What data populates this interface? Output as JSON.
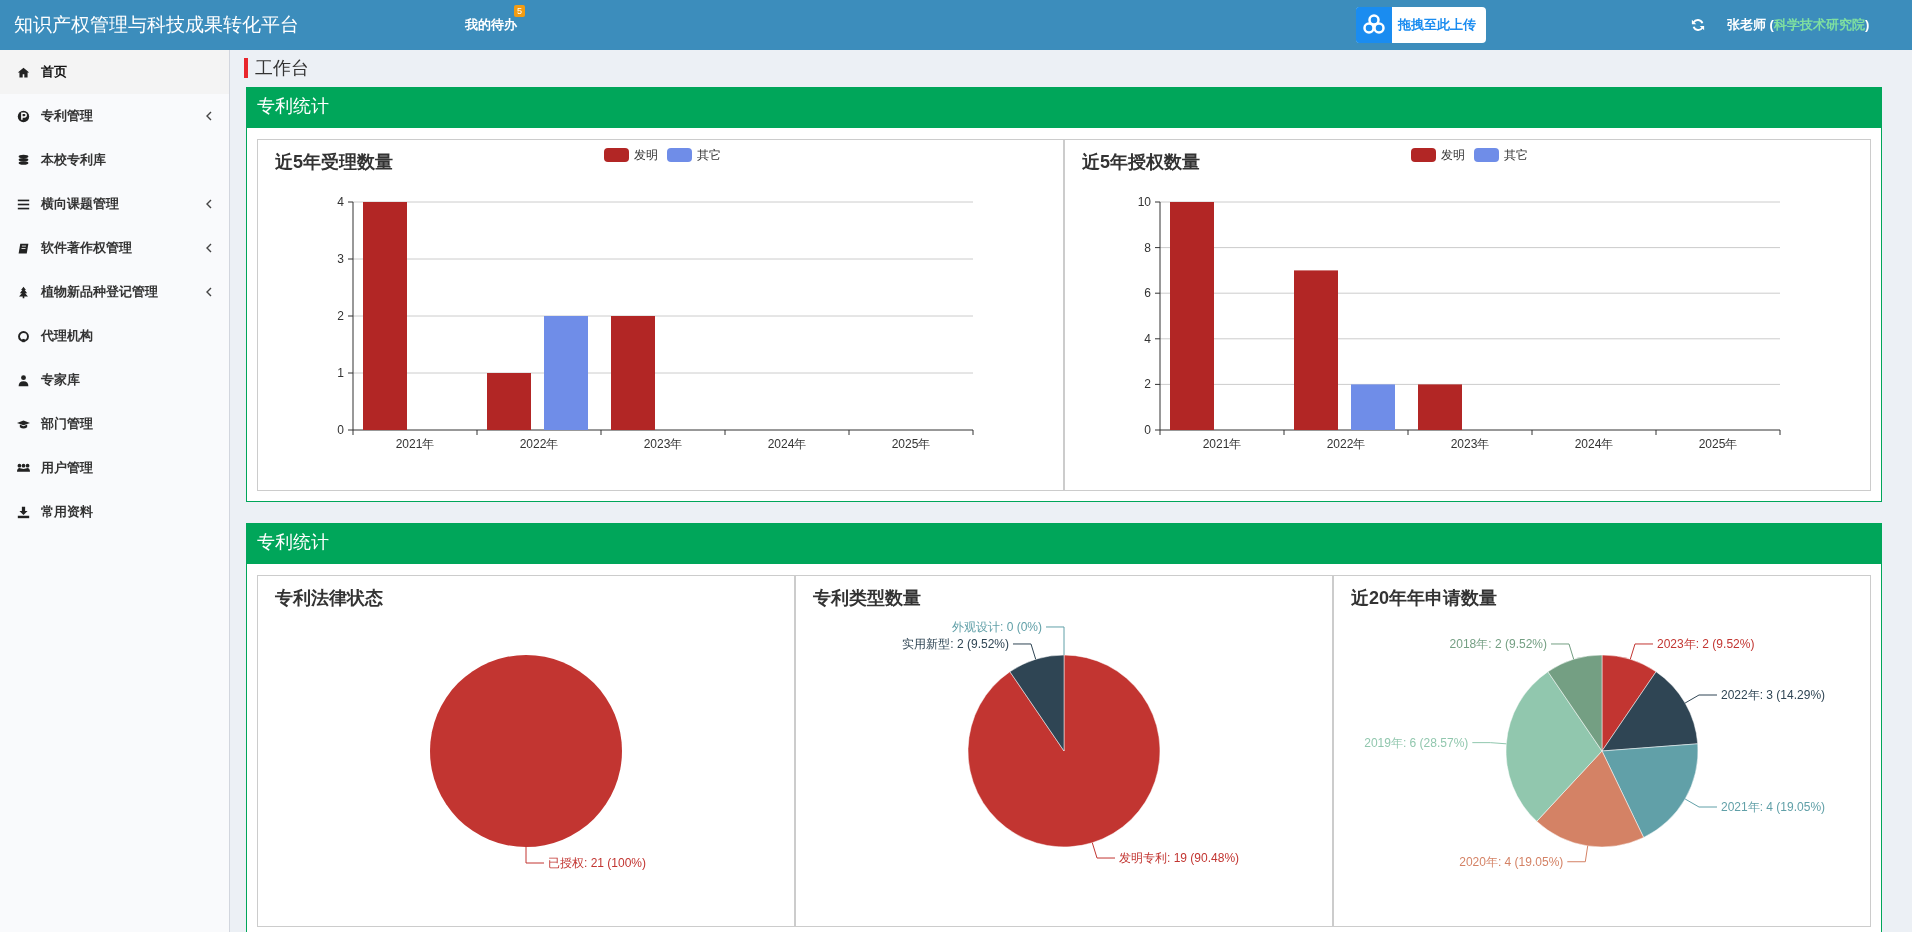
{
  "header": {
    "title": "知识产权管理与科技成果转化平台",
    "todo": {
      "label": "我的待办",
      "badge": "5"
    },
    "upload": {
      "label": "拖拽至此上传"
    },
    "user": "张老师 (**科学技术研究院**)"
  },
  "sidebar": {
    "items": [
      {
        "label": "首页",
        "selected": true,
        "submenu": false
      },
      {
        "label": "专利管理",
        "selected": false,
        "submenu": true
      },
      {
        "label": "本校专利库",
        "selected": false,
        "submenu": false
      },
      {
        "label": "横向课题管理",
        "selected": false,
        "submenu": true
      },
      {
        "label": "软件著作权管理",
        "selected": false,
        "submenu": true
      },
      {
        "label": "植物新品种登记管理",
        "selected": false,
        "submenu": true
      },
      {
        "label": "代理机构",
        "selected": false,
        "submenu": false
      },
      {
        "label": "专家库",
        "selected": false,
        "submenu": false
      },
      {
        "label": "部门管理",
        "selected": false,
        "submenu": false
      },
      {
        "label": "用户管理",
        "selected": false,
        "submenu": false
      },
      {
        "label": "常用资料",
        "selected": false,
        "submenu": false
      }
    ]
  },
  "breadcrumb": "工作台",
  "panels": [
    {
      "title": "专利统计",
      "charts": [
        {
          "chart_data": {
            "type": "bar",
            "title": "近5年受理数量",
            "categories": [
              "2021年",
              "2022年",
              "2023年",
              "2024年",
              "2025年"
            ],
            "series": [
              {
                "name": "发明",
                "color": "#b22625",
                "values": [
                  4,
                  1,
                  2,
                  0,
                  0
                ]
              },
              {
                "name": "其它",
                "color": "#6f8de8",
                "values": [
                  0,
                  2,
                  0,
                  0,
                  0
                ]
              }
            ],
            "ylim": [
              0,
              4
            ],
            "yticks": [
              0,
              1,
              2,
              3,
              4
            ],
            "grid": true,
            "legend": "top"
          }
        },
        {
          "chart_data": {
            "type": "bar",
            "title": "近5年授权数量",
            "categories": [
              "2021年",
              "2022年",
              "2023年",
              "2024年",
              "2025年"
            ],
            "series": [
              {
                "name": "发明",
                "color": "#b22625",
                "values": [
                  10,
                  7,
                  2,
                  0,
                  0
                ]
              },
              {
                "name": "其它",
                "color": "#6f8de8",
                "values": [
                  0,
                  2,
                  0,
                  0,
                  0
                ]
              }
            ],
            "ylim": [
              0,
              10
            ],
            "yticks": [
              0,
              2,
              4,
              6,
              8,
              10
            ],
            "grid": true,
            "legend": "top"
          }
        }
      ]
    },
    {
      "title": "专利统计",
      "charts": [
        {
          "chart_data": {
            "type": "pie",
            "title": "专利法律状态",
            "values": [
              21
            ],
            "colors": [
              "#c23531"
            ],
            "value_labels": [
              "已授权: 21 (100%)"
            ]
          }
        },
        {
          "chart_data": {
            "type": "pie",
            "title": "专利类型数量",
            "values": [
              19,
              2,
              0
            ],
            "colors": [
              "#c23531",
              "#2f4554",
              "#61a0a8"
            ],
            "value_labels": [
              "发明专利: 19 (90.48%)",
              "实用新型: 2 (9.52%)",
              "外观设计: 0 (0%)"
            ]
          }
        },
        {
          "chart_data": {
            "type": "pie",
            "title": "近20年年申请数量",
            "values": [
              2,
              3,
              4,
              4,
              6,
              2
            ],
            "colors": [
              "#c23531",
              "#2f4554",
              "#61a0a8",
              "#d48265",
              "#91c7ae",
              "#749f83"
            ],
            "value_labels": [
              "2023年: 2 (9.52%)",
              "2022年: 3 (14.29%)",
              "2021年: 4 (19.05%)",
              "2020年: 4 (19.05%)",
              "2019年: 6 (28.57%)",
              "2018年: 2 (9.52%)"
            ]
          }
        }
      ]
    }
  ]
}
